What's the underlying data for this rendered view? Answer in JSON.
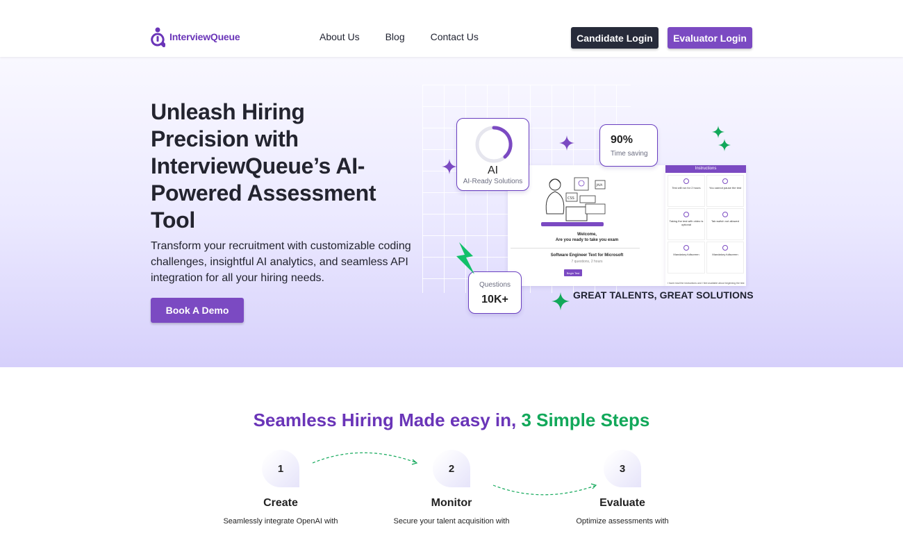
{
  "nav": {
    "brand": "InterviewQueue",
    "links": [
      "About Us",
      "Blog",
      "Contact Us"
    ],
    "candidate_login": "Candidate Login",
    "evaluator_login": "Evaluator Login"
  },
  "hero": {
    "title": "Unleash Hiring Precision with InterviewQueue’s AI-Powered Assessment Tool",
    "subtitle": "Transform your recruitment with customizable coding challenges, insightful AI analytics, and seamless API integration for all your hiring needs.",
    "cta": "Book A Demo"
  },
  "illustration": {
    "ai_card": {
      "label": "AI",
      "sub": "AI-Ready Solutions"
    },
    "time_card": {
      "value": "90%",
      "label": "Time saving"
    },
    "questions_card": {
      "label": "Questions",
      "value": "10K+"
    },
    "tagline": "GREAT TALENTS, GREAT SOLUTIONS",
    "screen": {
      "welcome_line1": "Welcome,",
      "welcome_line2": "Are you ready to take you exam",
      "test_name": "Software Engineer Text for Microsoft",
      "test_meta": "7 questions, 2 hours",
      "begin": "Begin Test"
    },
    "instructions": {
      "title": "Instructions",
      "cells": [
        "Test will run for 2 hours",
        "You cannot pause the test",
        "Taking the test with video is optional",
        "Tab switch not allowed",
        "Mandatory fullscreen",
        "Mandatory fullscreen"
      ],
      "footer": "I have read the instructions and I feel available about beginning the test"
    }
  },
  "steps": {
    "title_part1": "Seamless Hiring Made easy in, ",
    "title_part2": "3 Simple Steps",
    "items": [
      {
        "num": "1",
        "name": "Create",
        "desc": "Seamlessly integrate OpenAI with"
      },
      {
        "num": "2",
        "name": "Monitor",
        "desc": "Secure your talent acquisition with"
      },
      {
        "num": "3",
        "name": "Evaluate",
        "desc": "Optimize assessments with"
      }
    ]
  },
  "colors": {
    "brand_purple": "#7b4ac2",
    "dark_button": "#272b3a",
    "accent_green": "#12a85a"
  }
}
